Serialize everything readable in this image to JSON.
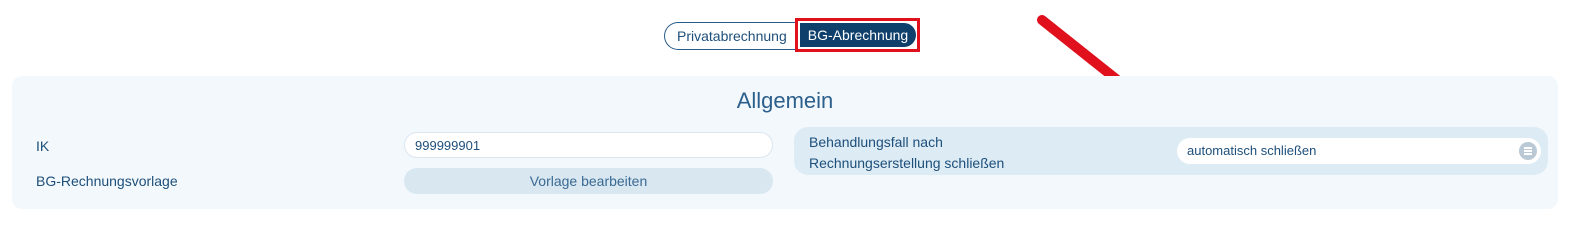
{
  "billing_toggle": {
    "private_label": "Privatabrechnung",
    "bg_label": "BG-Abrechnung"
  },
  "section": {
    "title": "Allgemein"
  },
  "ik": {
    "label": "IK",
    "value": "999999901"
  },
  "bg_template": {
    "label": "BG-Rechnungsvorlage",
    "button_label": "Vorlage bearbeiten"
  },
  "case_close": {
    "label_line1": "Behandlungsfall nach",
    "label_line2": "Rechnungserstellung schließen",
    "selected_value": "automatisch schließen",
    "icon": "list-icon"
  },
  "annotation": {
    "color": "#e0101c"
  }
}
